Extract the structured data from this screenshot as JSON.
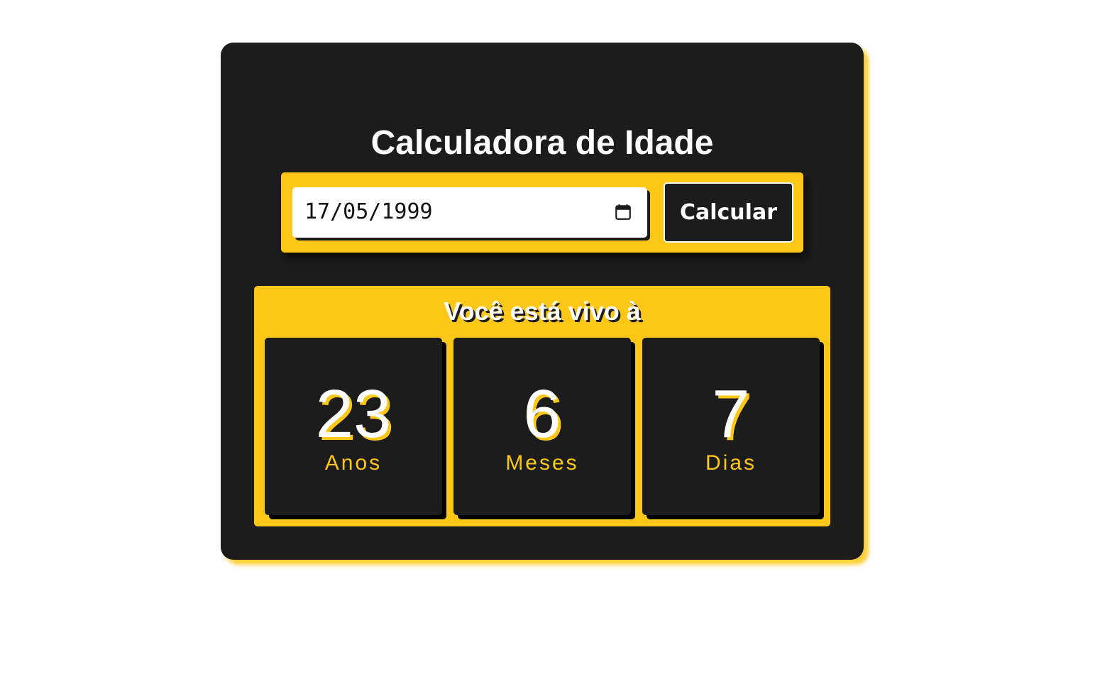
{
  "app": {
    "title": "Calculadora de Idade"
  },
  "form": {
    "date_value": "17/05/1999",
    "calculate_label": "Calcular",
    "calendar_icon": "calendar-icon"
  },
  "result": {
    "heading": "Você está vivo à",
    "items": [
      {
        "value": "23",
        "label": "Anos"
      },
      {
        "value": "6",
        "label": "Meses"
      },
      {
        "value": "7",
        "label": "Dias"
      }
    ]
  },
  "colors": {
    "accent": "#fcc716",
    "card_background": "#1c1c1c",
    "text": "#ffffff",
    "page_background": "#ffffff"
  }
}
